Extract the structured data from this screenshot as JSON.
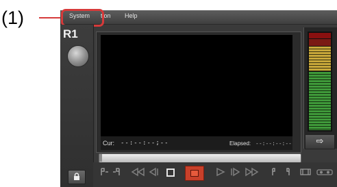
{
  "callout": {
    "label": "(1)"
  },
  "menubar": {
    "items": [
      "System",
      "tion",
      "Help"
    ]
  },
  "recorder": {
    "label": "R1"
  },
  "status": {
    "cur_label": "Cur:",
    "cur_value": "--:--:--;--",
    "elapsed_label": "Elapsed:",
    "elapsed_value": "--:--:--:--"
  },
  "meter": {
    "button_glyph": "⇨"
  },
  "icons": {
    "lock": "lock-icon",
    "in_out": "in-out-icon",
    "rewind": "rewind-icon",
    "step_back": "step-back-icon",
    "stop": "stop-icon",
    "record": "record-icon",
    "play": "play-icon",
    "step_forward": "step-forward-icon",
    "fast_forward": "fast-forward-icon"
  },
  "colors": {
    "highlight": "#d63a3a",
    "record": "#c8402a",
    "screen": "#000000"
  }
}
